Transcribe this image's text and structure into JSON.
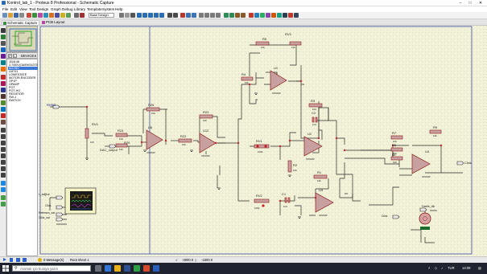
{
  "window": {
    "title": "Kontrol_lab_1 - Proteus 8 Professional - Schematic Capture",
    "min_icon": "minimize-icon",
    "max_icon": "maximize-icon",
    "close_icon": "close-icon"
  },
  "menu": [
    "File",
    "Edit",
    "View",
    "Tool",
    "Design",
    "Graph",
    "Debug",
    "Library",
    "Template",
    "System",
    "Help"
  ],
  "toolbar": {
    "select_value": "Base Design"
  },
  "tabs": [
    {
      "label": "Schematic Capture",
      "active": true,
      "icon": "schematic-icon"
    },
    {
      "label": "PCB Layout",
      "active": false,
      "icon": "pcb-icon"
    }
  ],
  "devices": {
    "p_label": "P",
    "l_label": "L",
    "title": "DEVICES",
    "items": [
      "1N4148",
      "2.7/50V(OA/BH34375)",
      "AO-INV",
      "LM741",
      "LOWESTATE",
      "MOTOR-ENCODER",
      "OP1P",
      "OPAMP",
      "POT",
      "POT-HG",
      "RESISTOR",
      "SW-1",
      "SWITCH"
    ],
    "selected_index": 2
  },
  "schematic": {
    "terminals": {
      "in": "RHSD",
      "dac": "DAC_output",
      "out": "Cikis",
      "scope_a": "L_adijkur",
      "scope_b": "Cikis",
      "scope_c": "Referans_sat",
      "scope_d": "Cikis_sat",
      "motor_top": "Daetle_dik",
      "motor_in": "Cikis"
    },
    "labels": {
      "r5": "R5",
      "r5v": "10k",
      "rv3": "RV3",
      "rv3v": "10k",
      "r4": "R4",
      "r4v": "10k",
      "u1": "U1",
      "u1t": "OPAMP",
      "r26": "R26",
      "r26v": "10k",
      "rv4": "RV4",
      "rv4v": "10k",
      "r24": "R24",
      "r24v": "10k",
      "r25": "R25",
      "r25v": "10k",
      "u6": "U6",
      "u6t": "OPAMP",
      "r23": "R23",
      "r23v": "10k",
      "r22": "R22",
      "r22v": "10k",
      "u12": "U12",
      "u12t": "OPAMP",
      "r3": "R3",
      "r3v": "10k",
      "c2": "C2",
      "c2v": "1nF",
      "rv1": "RV1",
      "rv1v": "100k",
      "u2": "U2",
      "u2t": "OPAMP",
      "r2": "R2",
      "r2v": "10k",
      "r1": "R1",
      "r1v": "10k",
      "c1": "C1",
      "c1v": "1nF",
      "rv2": "RV2",
      "rv2v": "100k",
      "u3": "U3",
      "u3t": "OPAMP",
      "r7": "R7",
      "r7v": "10k",
      "r9": "R9",
      "r9v": "10k",
      "r6": "R6",
      "r6v": "10k",
      "r8": "R8",
      "r8v": "10k",
      "u4": "U4",
      "u4t": "OPAMP"
    }
  },
  "status": {
    "messages": "0 Message(s)",
    "sheet": "Root sheet 1",
    "x": "-3000.0",
    "y": "-1500.0"
  },
  "taskbar": {
    "search": "Aramak için buraya yazın",
    "lang": "TUR",
    "time": "14:09"
  }
}
